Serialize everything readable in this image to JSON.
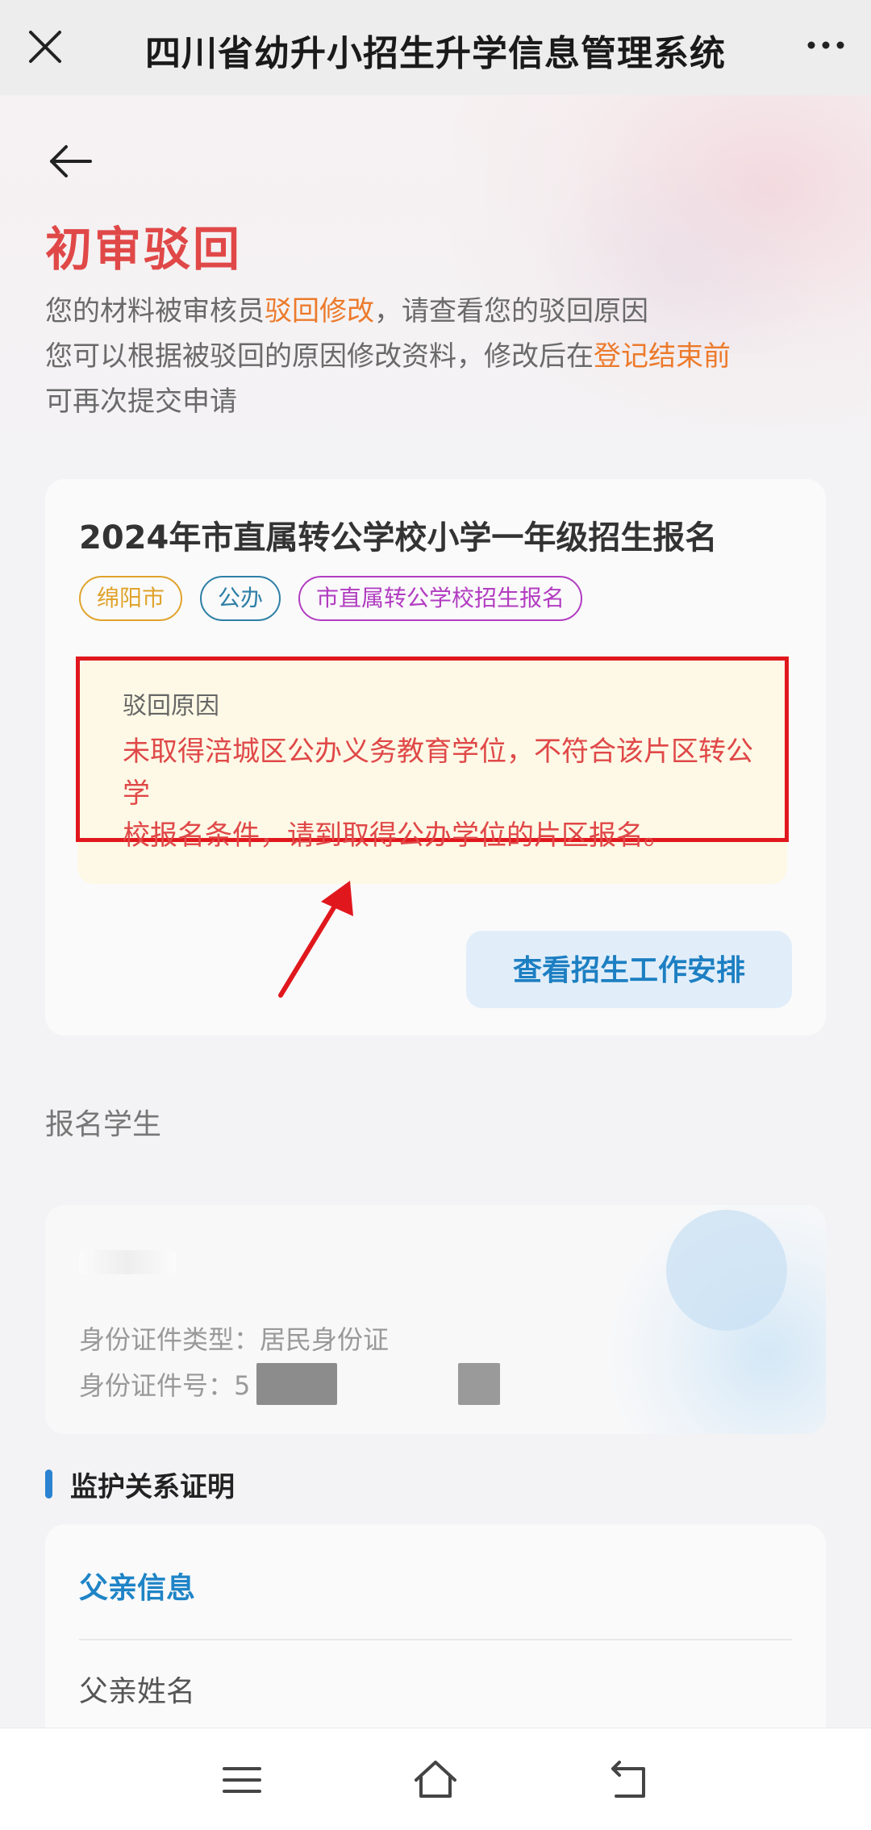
{
  "topbar": {
    "title": "四川省幼升小招生升学信息管理系统",
    "close_icon": "close-icon",
    "more_icon": "more-icon"
  },
  "header": {
    "status_title": "初审驳回",
    "desc_line1_prefix": "您的材料被审核员",
    "desc_line1_highlight": "驳回修改",
    "desc_line1_suffix": "，请查看您的驳回原因",
    "desc_line2_prefix": "您可以根据被驳回的原因修改资料，修改后在",
    "desc_line2_highlight": "登记结束前",
    "desc_line3": "可再次提交申请",
    "highlight_color": "#ec7a2b",
    "title_color": "#e04848"
  },
  "application": {
    "title": "2024年市直属转公学校小学一年级招生报名",
    "tags": [
      "绵阳市",
      "公办",
      "市直属转公学校招生报名"
    ],
    "reason_label": "驳回原因",
    "reason_line1": "未取得涪城区公办义务教育学位，不符合该片区转公学",
    "reason_line2": "校报名条件，请到取得公办学位的片区报名。",
    "schedule_button": "查看招生工作安排"
  },
  "student": {
    "section_label": "报名学生",
    "id_type": "身份证件类型：居民身份证",
    "id_number_prefix": "身份证件号：5"
  },
  "guardian": {
    "section_title": "监护关系证明",
    "father_info": "父亲信息",
    "father_name_label": "父亲姓名"
  },
  "navbar": {
    "icons": [
      "menu-icon",
      "home-icon",
      "back-icon"
    ]
  }
}
